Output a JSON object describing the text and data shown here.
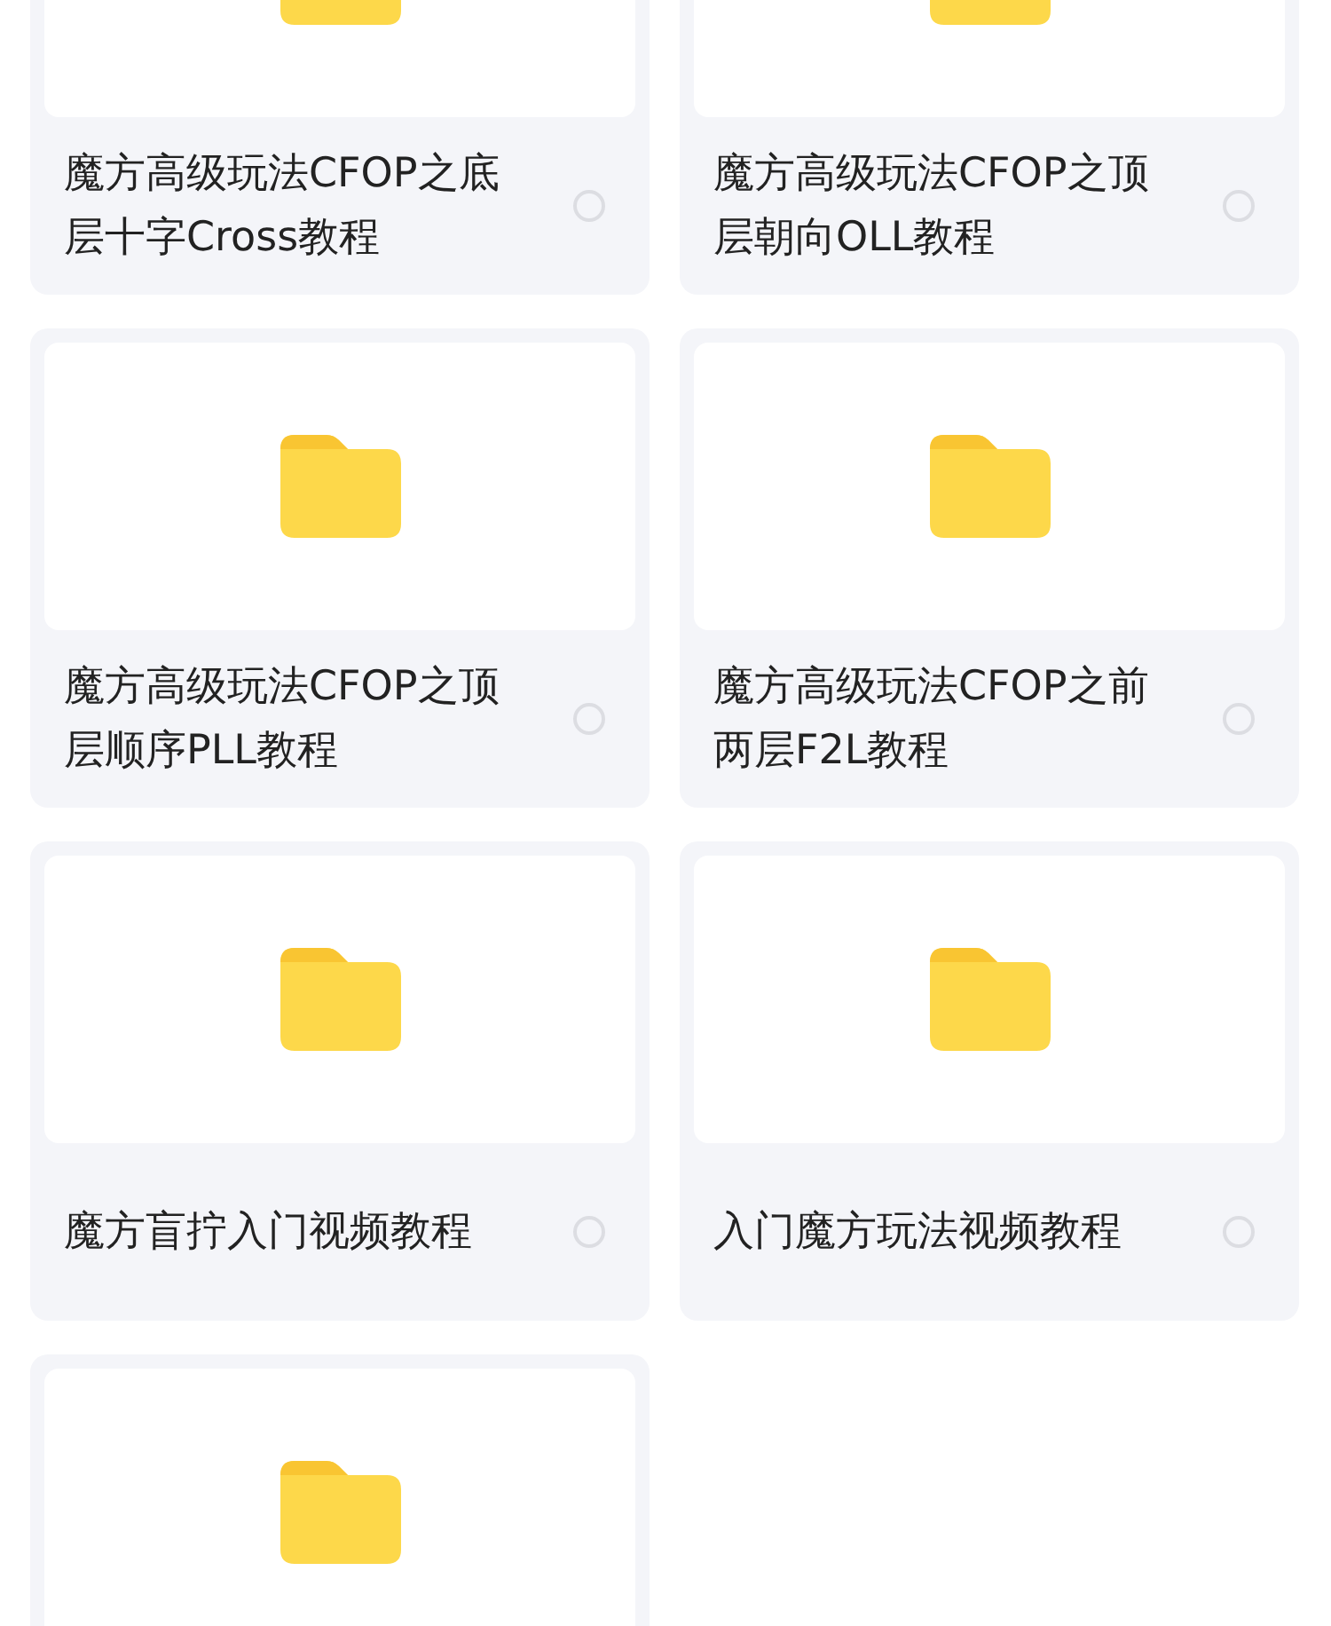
{
  "folders": [
    {
      "kind": "folder",
      "name": "魔方高级玩法CFOP之底层十字Cross教程",
      "selected": false
    },
    {
      "kind": "folder",
      "name": "魔方高级玩法CFOP之顶层朝向OLL教程",
      "selected": false
    },
    {
      "kind": "folder",
      "name": "魔方高级玩法CFOP之顶层顺序PLL教程",
      "selected": false
    },
    {
      "kind": "folder",
      "name": "魔方高级玩法CFOP之前两层F2L教程",
      "selected": false
    },
    {
      "kind": "folder",
      "name": "魔方盲拧入门视频教程",
      "selected": false
    },
    {
      "kind": "folder",
      "name": "入门魔方玩法视频教程",
      "selected": false
    },
    {
      "kind": "folder"
    }
  ]
}
